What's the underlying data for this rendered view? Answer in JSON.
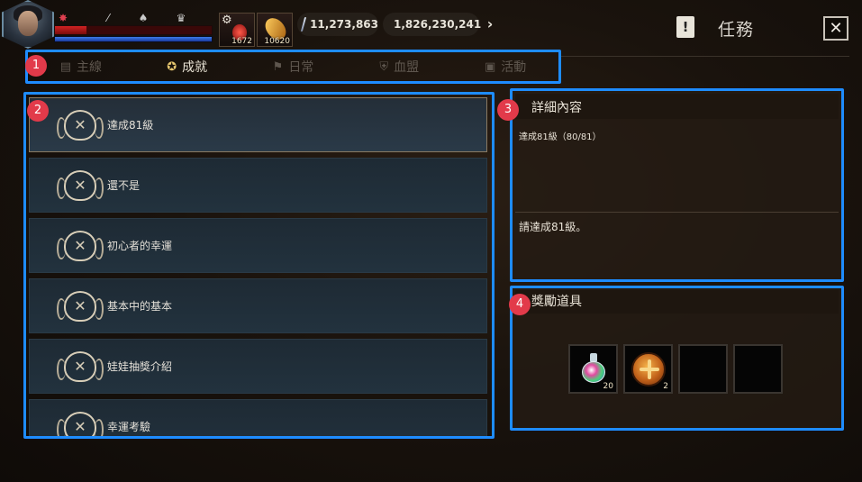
{
  "hud": {
    "potion_red_count": "1672",
    "potion_gold_count": "10620",
    "silver": "11,273,863",
    "gold": "1,826,230,241",
    "hp_fraction": 0.2,
    "mp_fraction": 1.0,
    "icons": [
      "pvp-icon",
      "sword-icon",
      "helmet-icon",
      "trophy-icon"
    ]
  },
  "window": {
    "title": "任務",
    "close": "✕",
    "icon": "!"
  },
  "tabs": [
    {
      "label": "主線",
      "icon": "book-icon",
      "active": false
    },
    {
      "label": "成就",
      "icon": "medal-icon",
      "active": true
    },
    {
      "label": "日常",
      "icon": "flag-icon",
      "active": false
    },
    {
      "label": "血盟",
      "icon": "shield-icon",
      "active": false
    },
    {
      "label": "活動",
      "icon": "gift-icon",
      "active": false
    }
  ],
  "badges": [
    "1",
    "2",
    "3",
    "4"
  ],
  "achievements": [
    {
      "label": "達成81級",
      "selected": true
    },
    {
      "label": "還不是",
      "selected": false
    },
    {
      "label": "初心者的幸運",
      "selected": false
    },
    {
      "label": "基本中的基本",
      "selected": false
    },
    {
      "label": "娃娃抽獎介紹",
      "selected": false
    },
    {
      "label": "幸運考驗",
      "selected": false
    }
  ],
  "detail": {
    "title": "詳細內容",
    "progress": "達成81級（80/81）",
    "description": "請達成81級。"
  },
  "reward": {
    "title": "獎勵道具",
    "items": [
      {
        "icon": "rainbow-potion-icon",
        "count": "20"
      },
      {
        "icon": "bronze-medal-icon",
        "count": "2"
      },
      {
        "icon": "empty-slot",
        "count": ""
      },
      {
        "icon": "empty-slot",
        "count": ""
      }
    ]
  },
  "colors": {
    "highlight_border": "#1e8cff",
    "badge": "#e23a4a"
  }
}
